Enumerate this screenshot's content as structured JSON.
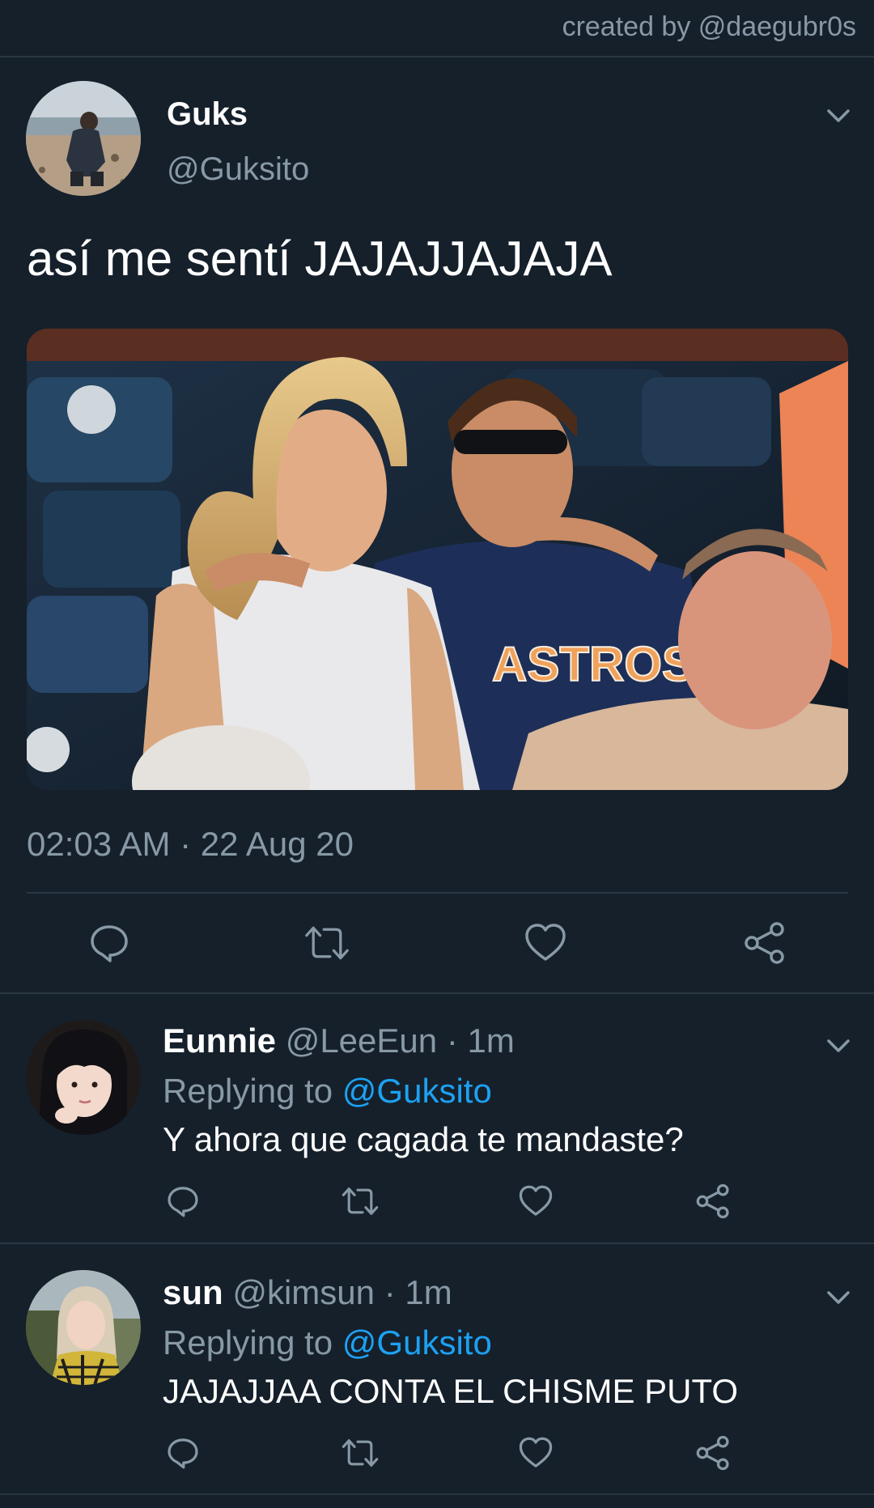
{
  "header": {
    "credit": "created by @daegubr0s"
  },
  "tweet": {
    "name": "Guks",
    "handle": "@Guksito",
    "text": "así me sentí JAJAJJAJAJA",
    "image_shirt_text": "ASTROS",
    "timestamp": "02:03 AM · 22 Aug 20",
    "actions": [
      "reply-icon",
      "retweet-icon",
      "like-icon",
      "share-icon"
    ]
  },
  "replies": [
    {
      "name": "Eunnie",
      "handle": "@LeeEun",
      "time": "· 1m",
      "replying_prefix": "Replying to",
      "replying_to": "@Guksito",
      "text": "Y ahora que cagada te mandaste?"
    },
    {
      "name": "sun",
      "handle": "@kimsun",
      "time": "· 1m",
      "replying_prefix": "Replying to",
      "replying_to": "@Guksito",
      "text": "JAJAJJAA CONTA EL CHISME PUTO"
    }
  ],
  "colors": {
    "background": "#15202b",
    "text": "#ffffff",
    "muted": "#8899a6",
    "link": "#1da1f2",
    "divider": "#2a3743"
  }
}
